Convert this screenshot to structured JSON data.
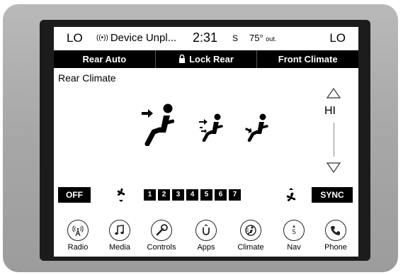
{
  "status": {
    "left_temp": "LO",
    "device_text": "Device Unpl...",
    "time": "2:31",
    "compass": "S",
    "outside_temp": "75°",
    "outside_temp_unit": "out.",
    "right_temp": "LO"
  },
  "tabs": [
    {
      "label": "Rear Auto"
    },
    {
      "label": "Lock Rear"
    },
    {
      "label": "Front Climate"
    }
  ],
  "climate": {
    "section_title": "Rear Climate",
    "fan_level_label": "HI",
    "off_label": "OFF",
    "sync_label": "SYNC",
    "fan_speeds": [
      "1",
      "2",
      "3",
      "4",
      "5",
      "6",
      "7"
    ]
  },
  "nav": [
    {
      "label": "Radio",
      "icon": "radio-icon"
    },
    {
      "label": "Media",
      "icon": "music-note-icon"
    },
    {
      "label": "Controls",
      "icon": "wrench-icon"
    },
    {
      "label": "Apps",
      "icon": "apps-icon"
    },
    {
      "label": "Climate",
      "icon": "climate-icon"
    },
    {
      "label": "Nav",
      "icon": "compass-icon"
    },
    {
      "label": "Phone",
      "icon": "phone-icon"
    }
  ]
}
